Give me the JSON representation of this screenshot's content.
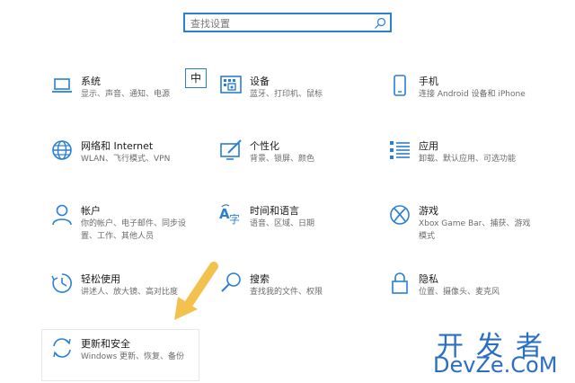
{
  "search": {
    "placeholder": "查找设置"
  },
  "ime": {
    "label": "中"
  },
  "tiles": [
    {
      "title": "系统",
      "sub": "显示、声音、通知、电源",
      "icon": "laptop-icon"
    },
    {
      "title": "设备",
      "sub": "蓝牙、打印机、鼠标",
      "icon": "keyboard-icon"
    },
    {
      "title": "手机",
      "sub": "连接 Android 设备和 iPhone",
      "icon": "phone-icon"
    },
    {
      "title": "网络和 Internet",
      "sub": "WLAN、飞行模式、VPN",
      "icon": "globe-icon"
    },
    {
      "title": "个性化",
      "sub": "背景、锁屏、颜色",
      "icon": "paint-icon"
    },
    {
      "title": "应用",
      "sub": "卸载、默认应用、可选功能",
      "icon": "apps-list-icon"
    },
    {
      "title": "帐户",
      "sub": "你的帐户、电子邮件、同步设",
      "sub2": "置、工作、其他人员",
      "icon": "person-icon"
    },
    {
      "title": "时间和语言",
      "sub": "语音、区域、日期",
      "icon": "language-icon"
    },
    {
      "title": "游戏",
      "sub": "Xbox Game Bar、捕获、游戏",
      "sub2": "模式",
      "icon": "xbox-icon"
    },
    {
      "title": "轻松使用",
      "sub": "讲述人、放大镜、高对比度",
      "icon": "ease-of-access-icon"
    },
    {
      "title": "搜索",
      "sub": "查找我的文件、权限",
      "icon": "search-icon"
    },
    {
      "title": "隐私",
      "sub": "位置、摄像头、麦克风",
      "icon": "lock-icon"
    },
    {
      "title": "更新和安全",
      "sub": "Windows 更新、恢复、备份",
      "icon": "sync-icon"
    }
  ],
  "watermark": {
    "cn": "开发者",
    "en": "DevZe.CoM"
  },
  "colors": {
    "accent": "#2a7fd4",
    "arrow": "#f2c14e"
  }
}
